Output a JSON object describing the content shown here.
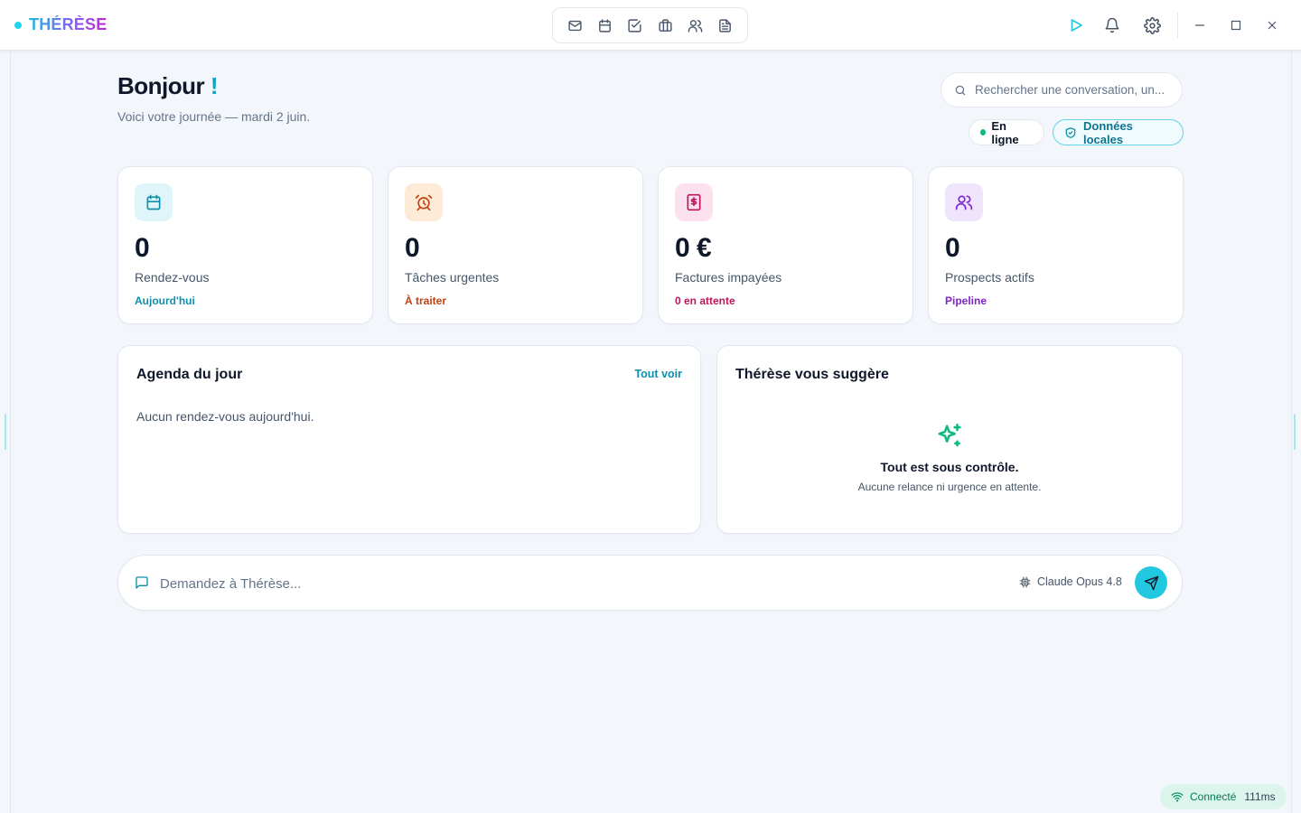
{
  "app": {
    "name": "THÉRÈSE"
  },
  "nav": {
    "items": [
      {
        "icon": "mail-icon"
      },
      {
        "icon": "calendar-icon"
      },
      {
        "icon": "tasks-icon"
      },
      {
        "icon": "briefcase-icon"
      },
      {
        "icon": "users-icon"
      },
      {
        "icon": "document-icon"
      }
    ]
  },
  "header": {
    "greeting": "Bonjour",
    "greeting_mark": "!",
    "subtitle": "Voici votre journée — mardi 2 juin."
  },
  "search": {
    "placeholder": "Rechercher une conversation, un..."
  },
  "badges": {
    "online": "En ligne",
    "local_data": "Données locales"
  },
  "stats": [
    {
      "value": "0",
      "label": "Rendez-vous",
      "sub": "Aujourd'hui",
      "icon": "calendar-icon",
      "accent": "#0e8fac",
      "bg": "#e0f5fa"
    },
    {
      "value": "0",
      "label": "Tâches urgentes",
      "sub": "À traiter",
      "icon": "alarm-clock-icon",
      "accent": "#c2410c",
      "bg": "#fdebd8"
    },
    {
      "value": "0 €",
      "label": "Factures impayées",
      "sub": "0 en attente",
      "icon": "invoice-icon",
      "accent": "#be185d",
      "bg": "#fbe1ee"
    },
    {
      "value": "0",
      "label": "Prospects actifs",
      "sub": "Pipeline",
      "icon": "users-icon",
      "accent": "#7e22ce",
      "bg": "#efe4fb"
    }
  ],
  "agenda": {
    "title": "Agenda du jour",
    "link": "Tout voir",
    "empty": "Aucun rendez-vous aujourd'hui."
  },
  "suggestions": {
    "title": "Thérèse vous suggère",
    "icon": "sparkles-icon",
    "headline": "Tout est sous contrôle.",
    "detail": "Aucune relance ni urgence en attente."
  },
  "chat": {
    "placeholder": "Demandez à Thérèse...",
    "model": "Claude Opus 4.8"
  },
  "status": {
    "label": "Connecté",
    "latency": "111ms"
  },
  "colors": {
    "accent": "#22c8e0",
    "online": "#10b981"
  }
}
